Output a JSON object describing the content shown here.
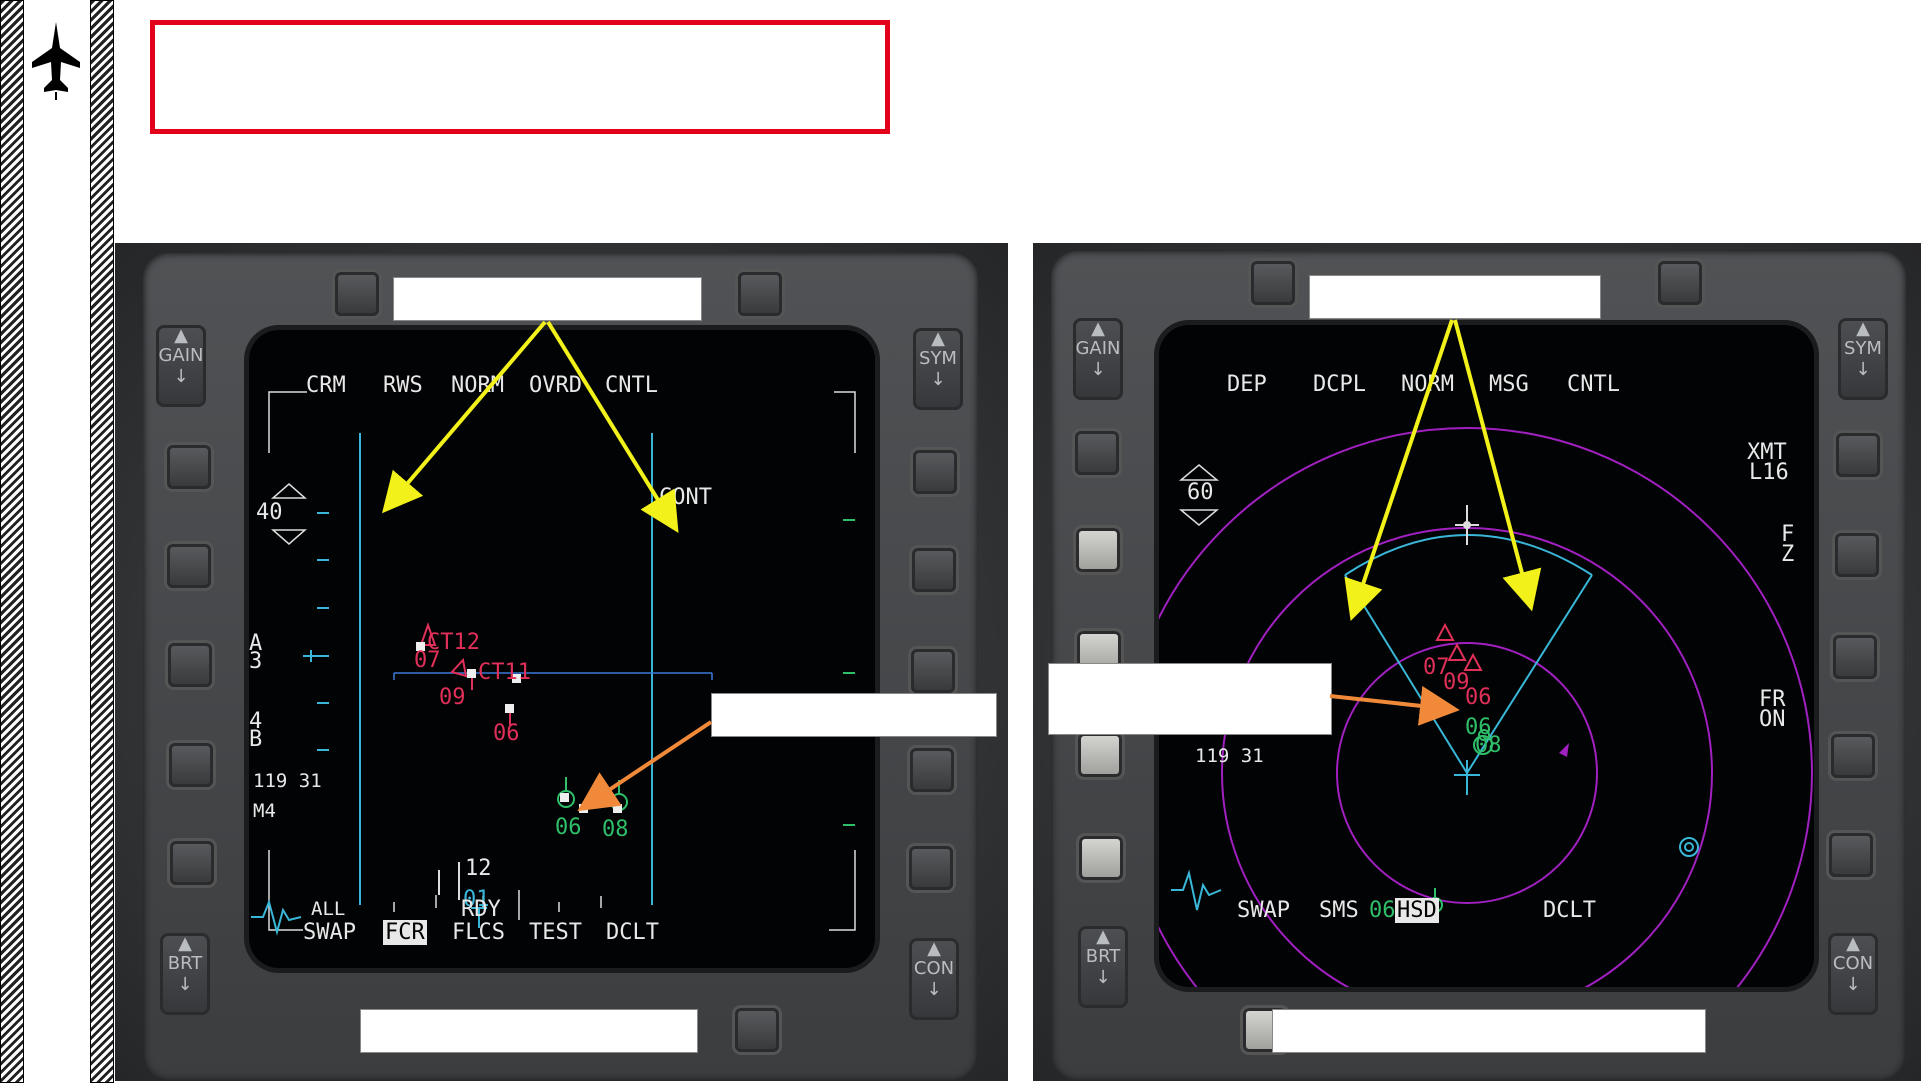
{
  "colors": {
    "accent": "#e3001b",
    "radar_blue": "#3ab7d8",
    "hostile": "#e0305a",
    "friendly": "#2fbf6a",
    "range_ring": "#a020c0",
    "arrow_yellow": "#f2f21a",
    "arrow_orange": "#f08a3a"
  },
  "left_mfd": {
    "top_labels": [
      "CRM",
      "RWS",
      "NORM",
      "OVRD",
      "CNTL"
    ],
    "bottom_labels": [
      "SWAP",
      "FCR",
      "FLCS",
      "TEST",
      "DCLT"
    ],
    "bottom_selected": "FCR",
    "all_label": "ALL",
    "rdy_label": "RDY",
    "range": "40",
    "az_bar": "A\n3",
    "bar_scan": "4\nB",
    "bullseye": "119 31",
    "mode": "M4",
    "cont": "CONT",
    "tracks": [
      {
        "label": "CT12",
        "alt": "07",
        "side": "hostile"
      },
      {
        "label": "CT11",
        "alt": "09",
        "side": "hostile"
      },
      {
        "label": "",
        "alt": "06",
        "side": "hostile"
      },
      {
        "label": "",
        "alt": "06",
        "side": "friendly"
      },
      {
        "label": "",
        "alt": "08",
        "side": "friendly"
      }
    ],
    "cursor_num": "12",
    "cursor_alt": "01",
    "side_buttons": {
      "gain": "GAIN",
      "sym": "SYM",
      "brt": "BRT",
      "con": "CON"
    }
  },
  "right_mfd": {
    "top_labels": [
      "DEP",
      "DCPL",
      "NORM",
      "MSG",
      "CNTL"
    ],
    "bottom_labels": [
      "SWAP",
      "SMS",
      "HSD",
      "DCLT"
    ],
    "bottom_selected": "HSD",
    "bottom_prefix": "06",
    "range": "60",
    "xmt": "XMT",
    "l16": "L16",
    "fz": "F\nZ",
    "fr": "FR",
    "on": "ON",
    "bullseye": "119 31",
    "tracks": [
      {
        "alt": "07",
        "side": "hostile"
      },
      {
        "alt": "09",
        "side": "hostile"
      },
      {
        "alt": "06",
        "side": "hostile"
      },
      {
        "alt": "06",
        "side": "friendly"
      },
      {
        "alt": "08",
        "side": "friendly"
      }
    ],
    "side_buttons": {
      "gain": "GAIN",
      "sym": "SYM",
      "brt": "BRT",
      "con": "CON"
    }
  },
  "icons": [
    "aircraft-icon",
    "bullseye-icon",
    "ownship-icon"
  ]
}
